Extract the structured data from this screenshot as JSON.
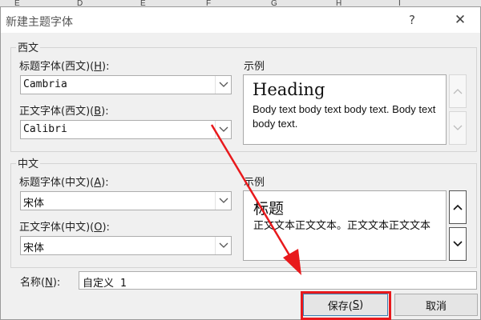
{
  "sheet": {
    "columns": [
      "E",
      "D",
      "E",
      "F",
      "G",
      "H",
      "I"
    ]
  },
  "dialog": {
    "title": "新建主题字体",
    "help_label": "?",
    "close_label": "✕",
    "western": {
      "group_title": "西文",
      "heading_label_pre": "标题字体(西文)(",
      "heading_label_key": "H",
      "heading_label_post": "):",
      "heading_font": "Cambria",
      "body_label_pre": "正文字体(西文)(",
      "body_label_key": "B",
      "body_label_post": "):",
      "body_font": "Calibri",
      "example_label": "示例",
      "preview_heading": "Heading",
      "preview_body": "Body text body text body text. Body text body text."
    },
    "chinese": {
      "group_title": "中文",
      "heading_label_pre": "标题字体(中文)(",
      "heading_label_key": "A",
      "heading_label_post": "):",
      "heading_font": "宋体",
      "body_label_pre": "正文字体(中文)(",
      "body_label_key": "O",
      "body_label_post": "):",
      "body_font": "宋体",
      "example_label": "示例",
      "preview_heading": "标题",
      "preview_body": "正文文本正文文本。正文文本正文文本"
    },
    "name_label_pre": "名称(",
    "name_label_key": "N",
    "name_label_post": "):",
    "name_value": "自定义 1",
    "save_label_pre": "保存(",
    "save_label_key": "S",
    "save_label_post": ")",
    "cancel_label": "取消"
  },
  "colors": {
    "highlight": "#e8191c",
    "dialog_bg": "#f0f0f0"
  },
  "icons": [
    "chevron-down-icon",
    "scroll-up-icon",
    "scroll-down-icon",
    "help-icon",
    "close-icon"
  ]
}
